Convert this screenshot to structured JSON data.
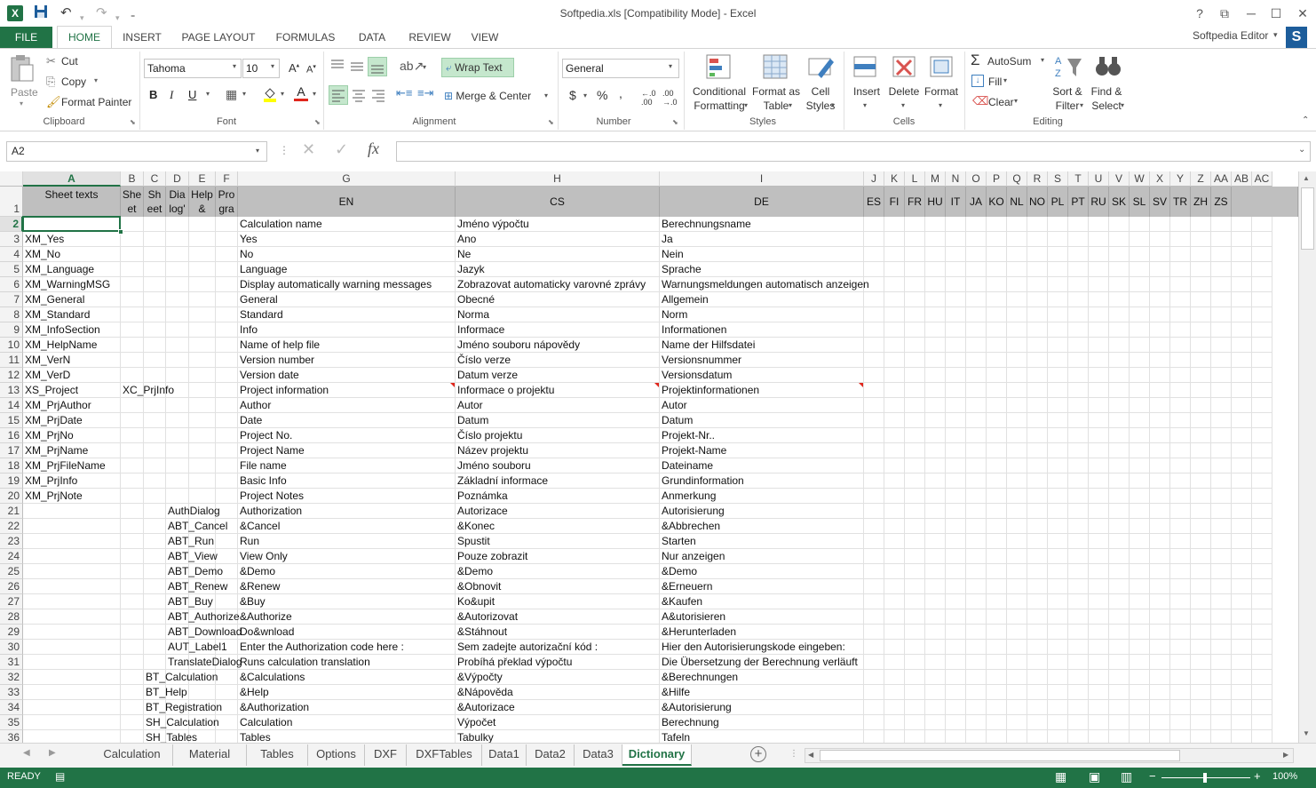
{
  "app": {
    "title": "Softpedia.xls  [Compatibility Mode] - Excel",
    "user": "Softpedia Editor",
    "user_initial": "S",
    "accent": "#217346"
  },
  "ribbon": {
    "file": "FILE",
    "tabs": [
      "HOME",
      "INSERT",
      "PAGE LAYOUT",
      "FORMULAS",
      "DATA",
      "REVIEW",
      "VIEW"
    ],
    "clipboard": {
      "label": "Clipboard",
      "paste": "Paste",
      "cut": "Cut",
      "copy": "Copy",
      "format_painter": "Format Painter"
    },
    "font": {
      "label": "Font",
      "family": "Tahoma",
      "size": "10",
      "bold": "B",
      "italic": "I",
      "underline": "U"
    },
    "alignment": {
      "label": "Alignment",
      "wrap": "Wrap Text",
      "merge": "Merge & Center"
    },
    "number": {
      "label": "Number",
      "format": "General",
      "currency": "$",
      "percent": "%",
      "comma": ","
    },
    "styles": {
      "label": "Styles",
      "cond1": "Conditional",
      "cond2": "Formatting",
      "fat1": "Format as",
      "fat2": "Table",
      "cs1": "Cell",
      "cs2": "Styles"
    },
    "cells": {
      "label": "Cells",
      "insert": "Insert",
      "delete": "Delete",
      "format": "Format"
    },
    "editing": {
      "label": "Editing",
      "autosum": "AutoSum",
      "fill": "Fill",
      "clear": "Clear",
      "sort1": "Sort &",
      "sort2": "Filter",
      "find1": "Find &",
      "find2": "Select"
    }
  },
  "formula": {
    "namebox": "A2",
    "fx": "fx",
    "content": ""
  },
  "columns": [
    "A",
    "B",
    "C",
    "D",
    "E",
    "F",
    "G",
    "H",
    "I",
    "J",
    "K",
    "L",
    "M",
    "N",
    "O",
    "P",
    "Q",
    "R",
    "S",
    "T",
    "U",
    "V",
    "W",
    "X",
    "Y",
    "Z",
    "AA",
    "AB",
    "AC"
  ],
  "header_row": {
    "A": "Sheet texts",
    "B": "She et",
    "C": "Sh eet",
    "D": "Dia log'",
    "E": "Help &",
    "F": "Pro gra",
    "G": "EN",
    "H": "CS",
    "I": "DE",
    "langs": [
      "ES",
      "FI",
      "FR",
      "HU",
      "IT",
      "JA",
      "KO",
      "NL",
      "NO",
      "PL",
      "PT",
      "RU",
      "SK",
      "SL",
      "SV",
      "TR",
      "ZH",
      "ZS"
    ]
  },
  "rows": [
    {
      "n": "2",
      "A": "",
      "B": "",
      "D": "",
      "G": "Calculation name",
      "H": "Jméno výpočtu",
      "I": "Berechnungsname"
    },
    {
      "n": "3",
      "A": "XM_Yes",
      "G": "Yes",
      "H": "Ano",
      "I": "Ja"
    },
    {
      "n": "4",
      "A": "XM_No",
      "G": "No",
      "H": "Ne",
      "I": "Nein"
    },
    {
      "n": "5",
      "A": "XM_Language",
      "G": "Language",
      "H": "Jazyk",
      "I": "Sprache"
    },
    {
      "n": "6",
      "A": "XM_WarningMSG",
      "G": "Display automatically warning messages",
      "H": "Zobrazovat automaticky varovné zprávy",
      "I": "Warnungsmeldungen automatisch anzeigen"
    },
    {
      "n": "7",
      "A": "XM_General",
      "G": "General",
      "H": "Obecné",
      "I": "Allgemein"
    },
    {
      "n": "8",
      "A": "XM_Standard",
      "G": "Standard",
      "H": "Norma",
      "I": "Norm"
    },
    {
      "n": "9",
      "A": "XM_InfoSection",
      "G": "Info",
      "H": "Informace",
      "I": "Informationen"
    },
    {
      "n": "10",
      "A": "XM_HelpName",
      "G": "Name of help file",
      "H": "Jméno souboru nápovědy",
      "I": "Name der Hilfsdatei"
    },
    {
      "n": "11",
      "A": "XM_VerN",
      "G": "Version number",
      "H": "Číslo verze",
      "I": "Versionsnummer"
    },
    {
      "n": "12",
      "A": "XM_VerD",
      "G": "Version date",
      "H": "Datum verze",
      "I": "Versionsdatum"
    },
    {
      "n": "13",
      "A": "XS_Project",
      "B": "XC_PrjInfo",
      "G": "Project information",
      "H": "Informace o projektu",
      "I": "Projektinformationen"
    },
    {
      "n": "14",
      "A": "XM_PrjAuthor",
      "G": "Author",
      "H": "Autor",
      "I": "Autor"
    },
    {
      "n": "15",
      "A": "XM_PrjDate",
      "G": "Date",
      "H": "Datum",
      "I": "Datum"
    },
    {
      "n": "16",
      "A": "XM_PrjNo",
      "G": "Project No.",
      "H": "Číslo projektu",
      "I": "Projekt-Nr.."
    },
    {
      "n": "17",
      "A": "XM_PrjName",
      "G": "Project Name",
      "H": "Název projektu",
      "I": "Projekt-Name"
    },
    {
      "n": "18",
      "A": "XM_PrjFileName",
      "G": "File name",
      "H": "Jméno souboru",
      "I": "Dateiname"
    },
    {
      "n": "19",
      "A": "XM_PrjInfo",
      "G": "Basic Info",
      "H": "Základní informace",
      "I": "Grundinformation"
    },
    {
      "n": "20",
      "A": "XM_PrjNote",
      "G": "Project Notes",
      "H": "Poznámka",
      "I": "Anmerkung"
    },
    {
      "n": "21",
      "D": "AuthDialog",
      "G": "Authorization",
      "H": "Autorizace",
      "I": "Autorisierung"
    },
    {
      "n": "22",
      "D": "ABT_Cancel",
      "G": "&Cancel",
      "H": "&Konec",
      "I": "&Abbrechen"
    },
    {
      "n": "23",
      "D": "ABT_Run",
      "G": "Run",
      "H": "Spustit",
      "I": "Starten"
    },
    {
      "n": "24",
      "D": "ABT_View",
      "G": "View Only",
      "H": "Pouze zobrazit",
      "I": "Nur anzeigen"
    },
    {
      "n": "25",
      "D": "ABT_Demo",
      "G": "&Demo",
      "H": "&Demo",
      "I": "&Demo"
    },
    {
      "n": "26",
      "D": "ABT_Renew",
      "G": "&Renew",
      "H": "&Obnovit",
      "I": "&Erneuern"
    },
    {
      "n": "27",
      "D": "ABT_Buy",
      "G": "&Buy",
      "H": "Ko&upit",
      "I": "&Kaufen"
    },
    {
      "n": "28",
      "D": "ABT_Authorize",
      "G": "&Authorize",
      "H": "&Autorizovat",
      "I": "A&utorisieren"
    },
    {
      "n": "29",
      "D": "ABT_Download",
      "G": "Do&wnload",
      "H": "&Stáhnout",
      "I": "&Herunterladen"
    },
    {
      "n": "30",
      "D": "AUT_Label1",
      "G": "Enter the Authorization code here :",
      "H": "Sem zadejte autorizační kód :",
      "I": "Hier den Autorisierungskode eingeben:"
    },
    {
      "n": "31",
      "D": "TranslateDialog",
      "G": "Runs calculation translation",
      "H": "Probíhá překlad výpočtu",
      "I": "Die Übersetzung der Berechnung verläuft"
    },
    {
      "n": "32",
      "C": "BT_Calculation",
      "G": "&Calculations",
      "H": "&Výpočty",
      "I": "&Berechnungen"
    },
    {
      "n": "33",
      "C": "BT_Help",
      "G": "&Help",
      "H": "&Nápověda",
      "I": "&Hilfe"
    },
    {
      "n": "34",
      "C": "BT_Registration",
      "G": "&Authorization",
      "H": "&Autorizace",
      "I": "&Autorisierung"
    },
    {
      "n": "35",
      "C": "SH_Calculation",
      "G": "Calculation",
      "H": "Výpočet",
      "I": "Berechnung"
    },
    {
      "n": "36",
      "C": "SH_Tables",
      "G": "Tables",
      "H": "Tabulky",
      "I": "Tafeln"
    }
  ],
  "sheets": [
    "Calculation",
    "Material",
    "Tables",
    "Options",
    "DXF",
    "DXFTables",
    "Data1",
    "Data2",
    "Data3",
    "Dictionary"
  ],
  "active_sheet": "Dictionary",
  "status": {
    "ready": "READY",
    "zoom": "100%"
  }
}
